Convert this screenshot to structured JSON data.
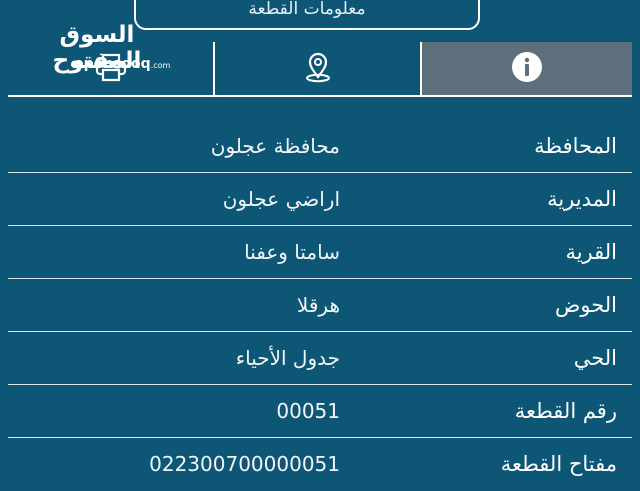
{
  "header": {
    "title": "معلومات القطعة"
  },
  "logo": {
    "arabic": "السوق المفتوح",
    "latin": "opensooq",
    "suffix": ".com"
  },
  "tabs": [
    {
      "id": "print",
      "icon": "printer-icon",
      "active": false
    },
    {
      "id": "location",
      "icon": "location-pin-icon",
      "active": false
    },
    {
      "id": "info",
      "icon": "info-icon",
      "active": true
    }
  ],
  "details": [
    {
      "label": "المحافظة",
      "value": "محافظة عجلون"
    },
    {
      "label": "المديرية",
      "value": "اراضي عجلون"
    },
    {
      "label": "القرية",
      "value": "سامتا وعفنا"
    },
    {
      "label": "الحوض",
      "value": "هرقلا"
    },
    {
      "label": "الحي",
      "value": "جدول الأحياء"
    },
    {
      "label": "رقم القطعة",
      "value": "00051"
    },
    {
      "label": "مفتاح القطعة",
      "value": "022300700000051"
    }
  ],
  "colors": {
    "background": "#0d5676",
    "active_tab": "#5c6f7b",
    "text": "#ffffff"
  }
}
